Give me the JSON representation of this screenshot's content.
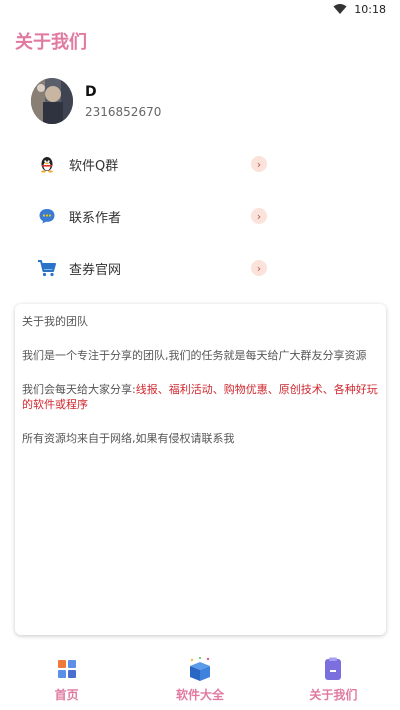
{
  "status_bar": {
    "time": "10:18"
  },
  "header": {
    "title": "关于我们"
  },
  "profile": {
    "name": "D",
    "id": "2316852670"
  },
  "menu": [
    {
      "label": "软件Q群",
      "icon": "qq-penguin-icon"
    },
    {
      "label": "联系作者",
      "icon": "chat-bubble-icon"
    },
    {
      "label": "查券官网",
      "icon": "shopping-cart-icon"
    }
  ],
  "about": {
    "title": "关于我的团队",
    "intro": "我们是一个专注于分享的团队,我们的任务就是每天给广大群友分享资源",
    "share_prefix": "我们会每天给大家分享:",
    "share_items": "线报、福利活动、购物优惠、原创技术、各种好玩的软件或程序",
    "disclaimer": "所有资源均来自于网络,如果有侵权请联系我"
  },
  "bottom_nav": [
    {
      "label": "首页",
      "icon": "home-grid-icon"
    },
    {
      "label": "软件大全",
      "icon": "gift-box-icon"
    },
    {
      "label": "关于我们",
      "icon": "clipboard-icon"
    }
  ],
  "colors": {
    "accent": "#e07aa0",
    "highlight_red": "#d0282f",
    "chevron_bg": "#fbe3dc"
  }
}
